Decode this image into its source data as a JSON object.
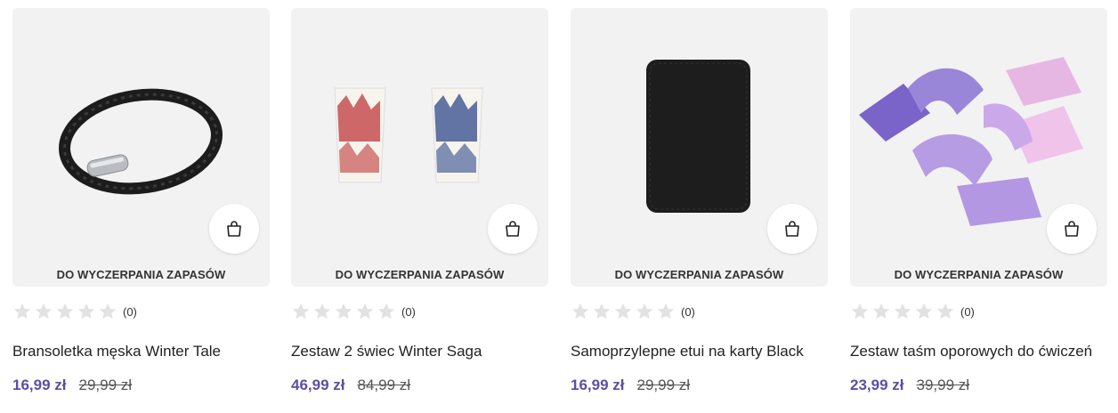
{
  "icons": {
    "cart": "shopping-bag-icon",
    "star": "star-outline-icon"
  },
  "colors": {
    "price": "#5b4fa3",
    "card_bg": "#f2f2f2",
    "star": "#d9d9d9"
  },
  "products": [
    {
      "badge": "DO WYCZERPANIA ZAPASÓW",
      "rating_count": "(0)",
      "name": "Bransoletka męska Winter Tale",
      "price": "16,99 zł",
      "old_price": "29,99 zł"
    },
    {
      "badge": "DO WYCZERPANIA ZAPASÓW",
      "rating_count": "(0)",
      "name": "Zestaw 2 świec Winter Saga",
      "price": "46,99 zł",
      "old_price": "84,99 zł"
    },
    {
      "badge": "DO WYCZERPANIA ZAPASÓW",
      "rating_count": "(0)",
      "name": "Samoprzylepne etui na karty Black",
      "price": "16,99 zł",
      "old_price": "29,99 zł"
    },
    {
      "badge": "DO WYCZERPANIA ZAPASÓW",
      "rating_count": "(0)",
      "name": "Zestaw taśm oporowych do ćwiczeń",
      "price": "23,99 zł",
      "old_price": "39,99 zł"
    }
  ]
}
